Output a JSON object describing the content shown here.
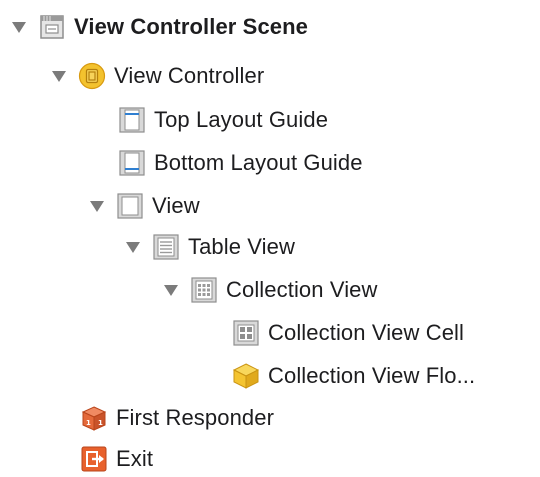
{
  "outline": {
    "scene": {
      "label": "View Controller Scene",
      "expanded": true,
      "icon": "scene-icon"
    },
    "view_controller": {
      "label": "View Controller",
      "expanded": true,
      "icon": "view-controller-icon"
    },
    "top_layout_guide": {
      "label": "Top Layout Guide",
      "icon": "top-layout-guide-icon"
    },
    "bottom_layout_guide": {
      "label": "Bottom Layout Guide",
      "icon": "bottom-layout-guide-icon"
    },
    "view": {
      "label": "View",
      "expanded": true,
      "icon": "view-icon"
    },
    "table_view": {
      "label": "Table View",
      "expanded": true,
      "icon": "table-view-icon"
    },
    "collection_view": {
      "label": "Collection View",
      "expanded": true,
      "icon": "collection-view-icon"
    },
    "collection_view_cell": {
      "label": "Collection View Cell",
      "icon": "collection-view-cell-icon"
    },
    "collection_view_flow_layout": {
      "label": "Collection View Flo...",
      "icon": "flow-layout-cube-icon"
    },
    "first_responder": {
      "label": "First Responder",
      "icon": "first-responder-icon"
    },
    "exit": {
      "label": "Exit",
      "icon": "exit-icon"
    }
  },
  "colors": {
    "disclosure": "#7b7b7b",
    "icon_gray": "#c8c8c8",
    "icon_border": "#8e8e8e",
    "vc_yellow": "#f3c22e",
    "vc_orange": "#d89a10",
    "responder_orange": "#e4693a",
    "exit_orange": "#e8612c",
    "cube_yellow": "#f4c431"
  }
}
